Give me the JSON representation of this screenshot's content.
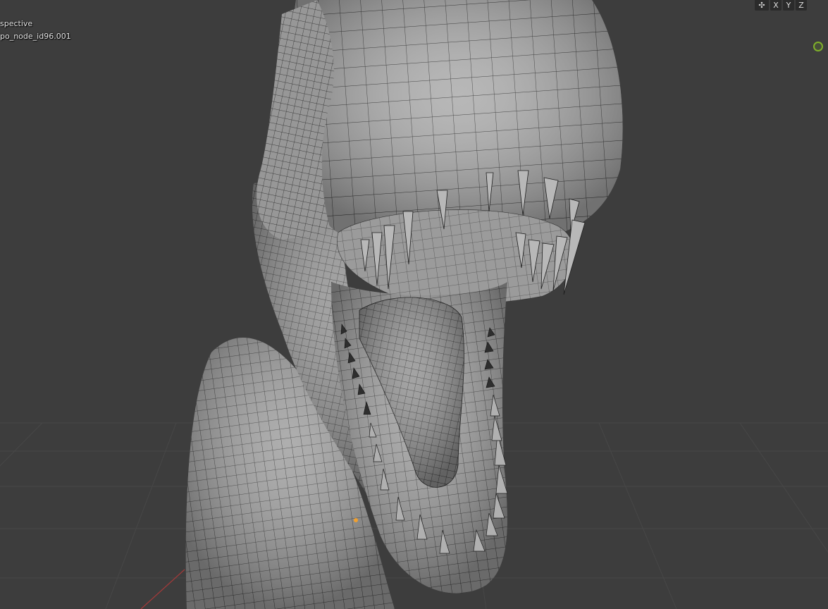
{
  "viewport": {
    "view_mode": "spective",
    "object_name": "po_node_id96.001"
  },
  "header_tools": {
    "axes": [
      "X",
      "Y",
      "Z"
    ]
  },
  "icons": {
    "axis_lock": "axis-lock-icon",
    "gizmo": "navigation-gizmo-icon",
    "origin": "object-origin-icon"
  },
  "colors": {
    "background": "#3d3d3d",
    "mesh_fill": "#9a9a9a",
    "wire": "#1e1e1e",
    "gizmo_accent": "#7fb02a",
    "origin_accent": "#f0a030"
  }
}
